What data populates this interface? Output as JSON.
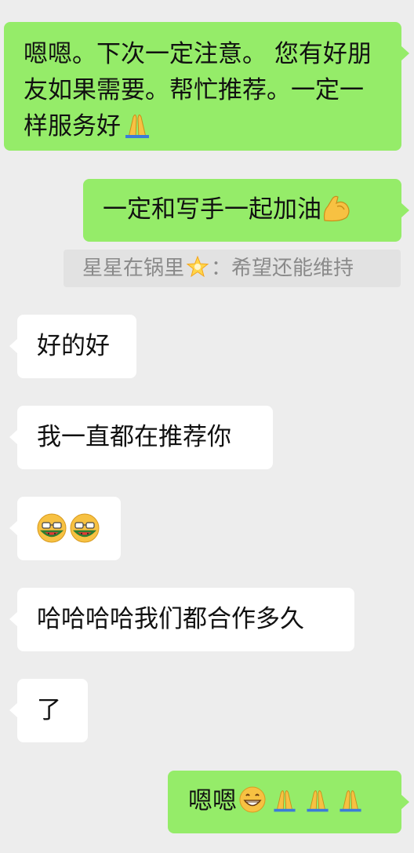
{
  "messages": [
    {
      "id": "m1",
      "side": "out",
      "text": "嗯嗯。下次一定注意。 您有好朋友如果需要。帮忙推荐。一定一样服务好",
      "emoji": [
        "pray"
      ]
    },
    {
      "id": "m2",
      "side": "out",
      "text": "一定和写手一起加油",
      "emoji": [
        "flexed-biceps"
      ]
    },
    {
      "id": "m3",
      "side": "in",
      "text": "好的好"
    },
    {
      "id": "m4",
      "side": "in",
      "text": "我一直都在推荐你"
    },
    {
      "id": "m5",
      "side": "in",
      "text": "",
      "emoji": [
        "watermelon-face",
        "watermelon-face"
      ]
    },
    {
      "id": "m6",
      "side": "in",
      "text": "哈哈哈哈我们都合作多久"
    },
    {
      "id": "m7",
      "side": "in",
      "text": "了"
    },
    {
      "id": "m8",
      "side": "out",
      "text": "嗯嗯",
      "emoji": [
        "grin",
        "pray",
        "pray",
        "pray"
      ]
    }
  ],
  "quote": {
    "author": "星星在锅里",
    "author_emoji": "star",
    "separator": "：",
    "text": "希望还能维持"
  },
  "colors": {
    "outgoing_bubble": "#95ec69",
    "incoming_bubble": "#ffffff",
    "background": "#ededed",
    "quote_bg": "#e2e2e2",
    "quote_text": "#8a8a8a"
  }
}
